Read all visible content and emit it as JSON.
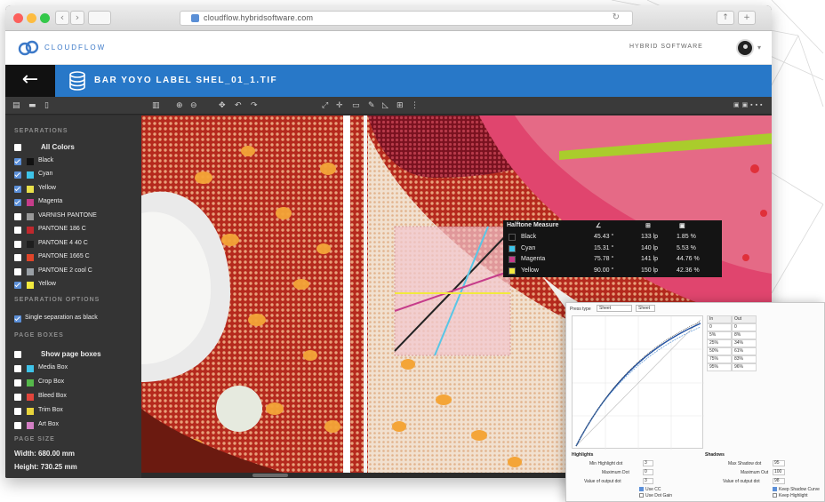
{
  "browser": {
    "url": "cloudflow.hybridsoftware.com",
    "nav_back": "‹",
    "nav_forward": "›",
    "reload": "↻",
    "btn_share": "↑",
    "btn_add": "+"
  },
  "header": {
    "brand": "CLOUDFLOW",
    "user": "HYBRID SOFTWARE"
  },
  "titlebar": {
    "back": "←",
    "file_title": "BAR YOYO LABEL SHEL_01_1.TIF"
  },
  "toolbar": {
    "icons": [
      "grid-icon",
      "list-icon",
      "page-icon",
      "split-icon",
      "zoom-in-icon",
      "zoom-out-icon",
      "hand-icon",
      "undo-icon",
      "redo-icon",
      "measure-icon",
      "crosshair-icon",
      "compare-icon",
      "pen-icon",
      "ruler-icon",
      "layers-icon"
    ],
    "glyphs": [
      "▤",
      "▬",
      "▯",
      "▥",
      "⊕",
      "⊖",
      "✥",
      "↶",
      "↷",
      "⤢",
      "✛",
      "▭",
      "✎",
      "◺",
      "⊞",
      "⋮"
    ],
    "right_label": "▣ ▣ ▪ ▪ ▪"
  },
  "sidebar": {
    "separations_title": "SEPARATIONS",
    "separations": [
      {
        "label": "All Colors",
        "checked": false,
        "color": ""
      },
      {
        "label": "Black",
        "checked": true,
        "color": "#111111"
      },
      {
        "label": "Cyan",
        "checked": true,
        "color": "#3ec3e8"
      },
      {
        "label": "Yellow",
        "checked": true,
        "color": "#e9e14a"
      },
      {
        "label": "Magenta",
        "checked": true,
        "color": "#c63c8a"
      },
      {
        "label": "VARNISH PANTONE",
        "checked": false,
        "color": "#999999"
      },
      {
        "label": "PANTONE 186 C",
        "checked": false,
        "color": "#c0282d"
      },
      {
        "label": "PANTONE 4 40 C",
        "checked": false,
        "color": "#1e1e1e"
      },
      {
        "label": "PANTONE 1665 C",
        "checked": false,
        "color": "#e0452a"
      },
      {
        "label": "PANTONE 2 cool C",
        "checked": false,
        "color": "#9aa0a6"
      },
      {
        "label": "Yellow",
        "checked": true,
        "color": "#f2e93e"
      }
    ],
    "options_title": "SEPARATION OPTIONS",
    "single_sep": {
      "label": "Single separation as black",
      "checked": true
    },
    "boxes_title": "PAGE BOXES",
    "boxes": [
      {
        "label": "Show page boxes",
        "checked": false,
        "color": ""
      },
      {
        "label": "Media Box",
        "checked": false,
        "color": "#3ec3e8"
      },
      {
        "label": "Crop Box",
        "checked": false,
        "color": "#55b84a"
      },
      {
        "label": "Bleed Box",
        "checked": false,
        "color": "#e2453c"
      },
      {
        "label": "Trim Box",
        "checked": false,
        "color": "#e8d43c"
      },
      {
        "label": "Art Box",
        "checked": false,
        "color": "#d37fc4"
      }
    ],
    "page_size_title": "PAGE SIZE",
    "width": "Width: 680.00 mm",
    "height": "Height: 730.25 mm"
  },
  "measure": {
    "title": "Halftone Measure",
    "col1": "∠",
    "col2": "⊞",
    "col3": "▣",
    "rows": [
      {
        "name": "Black",
        "color": "#111111",
        "angle": "45.43 °",
        "lpi": "133 lp",
        "pct": "1.85 %"
      },
      {
        "name": "Cyan",
        "color": "#3ec3e8",
        "angle": "15.31 °",
        "lpi": "140 lp",
        "pct": "5.53 %"
      },
      {
        "name": "Magenta",
        "color": "#c63c8a",
        "angle": "75.78 °",
        "lpi": "141 lp",
        "pct": "44.76 %"
      },
      {
        "name": "Yellow",
        "color": "#f2e93e",
        "angle": "90.00 °",
        "lpi": "150 lp",
        "pct": "42.36 %"
      }
    ]
  },
  "dialog": {
    "top_label": "Press type",
    "select1": "Sheet",
    "select2": "Sheet",
    "grid_header": [
      "In",
      "Out"
    ],
    "grid_rows": [
      [
        "0",
        "0"
      ],
      [
        "5%",
        "8%"
      ],
      [
        "25%",
        "34%"
      ],
      [
        "50%",
        "61%"
      ],
      [
        "75%",
        "83%"
      ],
      [
        "95%",
        "96%"
      ]
    ],
    "highlights_title": "Highlights",
    "hl_min": "Min Highlight dot",
    "hl_min_val": "3",
    "hl_max": "Maximum Dot",
    "hl_max_val": "0",
    "hl_value": "Value of output dot",
    "hl_value_val": "3",
    "shadows_title": "Shadows",
    "sh_max": "Max Shadow dot",
    "sh_max_val": "95",
    "sh_maxout": "Maximum Out",
    "sh_maxout_val": "100",
    "sh_value": "Value of output dot",
    "sh_value_val": "98",
    "opt1": "Use CC",
    "opt2": "Use Dot Gain",
    "opt3": "Keep Shadow Curve",
    "opt4": "Keep Highlight"
  }
}
